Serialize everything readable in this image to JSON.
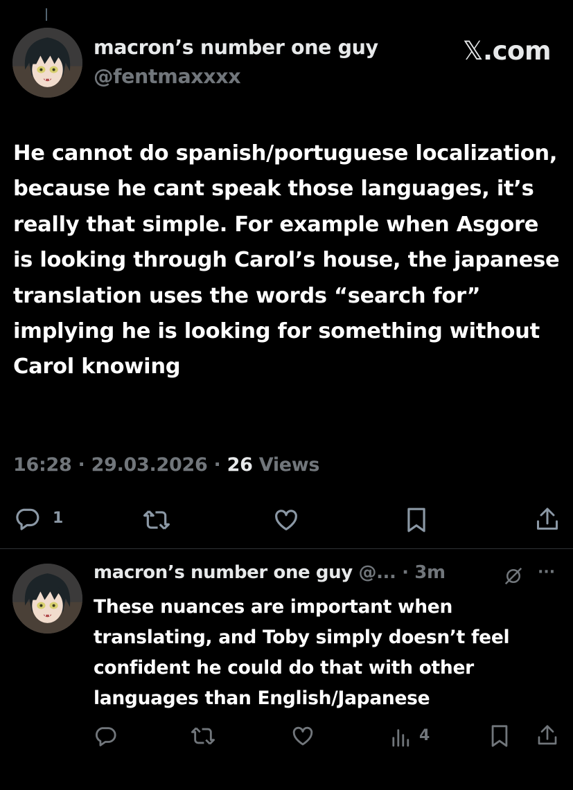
{
  "brand": {
    "text": ".com",
    "icon": "x-logo-icon"
  },
  "tweet": {
    "author_name": "macron’s number one guy",
    "handle": "@fentmaxxxx",
    "body": "He cannot do spanish/portuguese localization, because he cant speak those languages, it’s really that simple. For example when Asgore is looking through Carol’s house, the japanese translation uses the words “search for” implying he is looking for something without Carol knowing",
    "time": "16:28",
    "date": "29.03.2026",
    "views_count": "26",
    "views_label": "Views",
    "separator": " · ",
    "reply_count": "1"
  },
  "reply": {
    "author_name": "macron’s number one guy",
    "handle_truncated": "@...",
    "age": "3m",
    "separator": " · ",
    "body": "These nuances are important when translating, and Toby simply doesn’t feel confident he could do that with other languages than English/Japanese",
    "views_count": "4",
    "more": "···"
  },
  "colors": {
    "background": "#000000",
    "text": "#e7e9ea",
    "muted": "#71767b",
    "divider": "#2f3336"
  }
}
